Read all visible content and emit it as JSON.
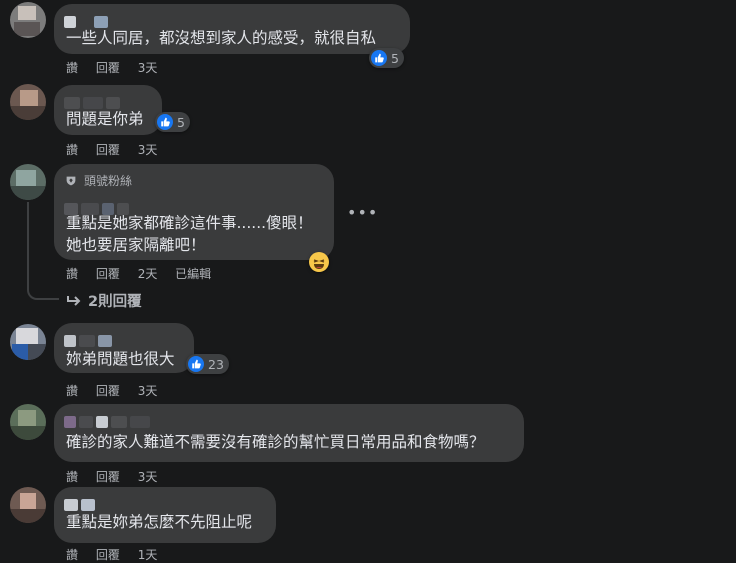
{
  "actions": {
    "like_label": "讚",
    "reply_label": "回覆"
  },
  "comments": [
    {
      "text": "一些人同居，都沒想到家人的感受，就很自私",
      "time": "3天",
      "reactions": "5"
    },
    {
      "text": "問題是你弟",
      "time": "3天",
      "reactions": "5"
    },
    {
      "badge": "頭號粉絲",
      "text_line1": "重點是她家都確診這件事......傻眼！",
      "text_line2": "她也要居家隔離吧！",
      "time": "2天",
      "edited": "已編輯",
      "reply_count": "2則回覆"
    },
    {
      "text": "妳弟問題也很大",
      "time": "3天",
      "reactions": "23"
    },
    {
      "text": "確診的家人難道不需要沒有確診的幫忙買日常用品和食物嗎？",
      "time": "3天"
    },
    {
      "text": "重點是妳弟怎麼不先阻止呢",
      "time": "1天"
    }
  ],
  "colors": {
    "background": "#18191a",
    "bubble": "#3a3b3c",
    "like_blue": "#1877f2",
    "muted_text": "#b0b3b8"
  },
  "icons": {
    "like": "thumbs-up-icon",
    "laugh": "laugh-emoji-icon",
    "fan_badge": "top-fan-badge-icon",
    "more": "more-options-icon",
    "reply_arrow": "reply-arrow-icon"
  }
}
